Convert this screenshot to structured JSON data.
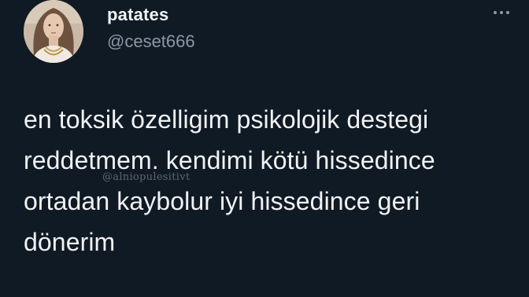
{
  "tweet": {
    "display_name": "patates",
    "handle": "@ceset666",
    "text_lines": [
      "en toksik özelligim psikolojik destegi",
      "reddetmem. kendimi kötü hissedince",
      "ortadan kaybolur iyi hissedince geri",
      "dönerim"
    ],
    "more_icon": "more-horizontal-icon"
  },
  "watermark": "@alniopulesitivt",
  "colors": {
    "background": "#101a24",
    "text": "#f0f2f4",
    "secondary": "#8b98a5"
  }
}
